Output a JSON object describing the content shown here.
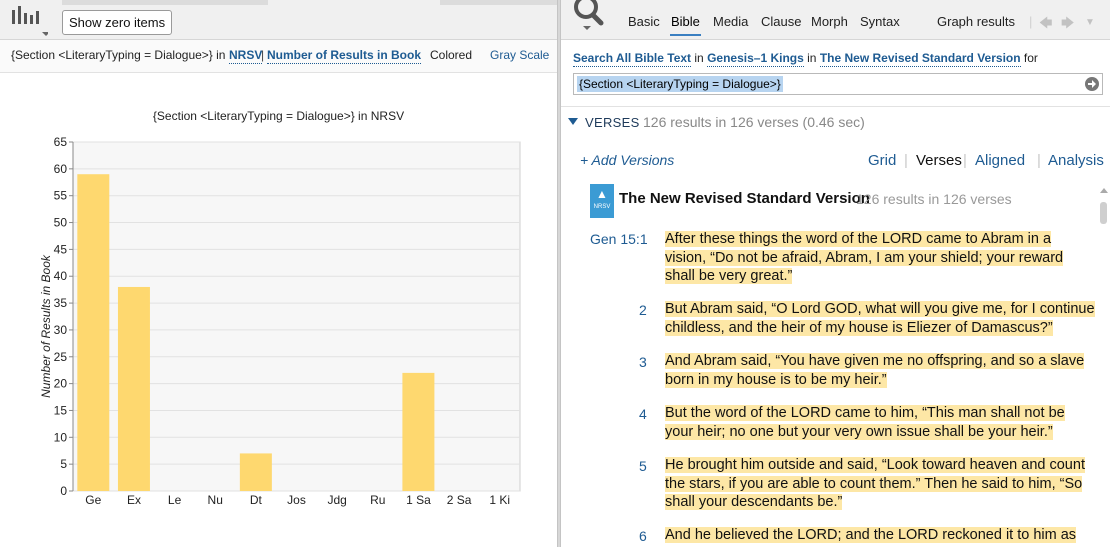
{
  "left_panel": {
    "show_zero_button": "Show zero items",
    "query_label": "{Section <LiteraryTyping = Dialogue>} in",
    "version_link": "NRSV",
    "separator": "|",
    "metric_link": "Number of Results in Book",
    "colored_label": "Colored",
    "grayscale_label": "Gray Scale"
  },
  "chart_data": {
    "type": "bar",
    "title": "{Section <LiteraryTyping = Dialogue>} in NRSV",
    "xlabel": "",
    "ylabel": "Number of Results in Book",
    "categories": [
      "Ge",
      "Ex",
      "Le",
      "Nu",
      "Dt",
      "Jos",
      "Jdg",
      "Ru",
      "1 Sa",
      "2 Sa",
      "1 Ki"
    ],
    "values": [
      59,
      38,
      0,
      0,
      7,
      0,
      0,
      0,
      22,
      0,
      0
    ],
    "ylim": [
      0,
      65
    ],
    "yticks": [
      0,
      5,
      10,
      15,
      20,
      25,
      30,
      35,
      40,
      45,
      50,
      55,
      60,
      65
    ],
    "grid": true,
    "bar_color": "#fed86f"
  },
  "right_panel": {
    "tabs": [
      "Basic",
      "Bible",
      "Media",
      "Clause",
      "Morph",
      "Syntax",
      "Graph results"
    ],
    "active_tab": "Bible",
    "search_line": {
      "prefix": "Search All Bible Text",
      "in1": "in",
      "range": "Genesis–1 Kings",
      "in2": "in",
      "version": "The New Revised Standard Version",
      "for": "for"
    },
    "search_query": "{Section <LiteraryTyping = Dialogue>}",
    "verses_header": "VERSES",
    "verses_count": "126 results in 126 verses (0.46 sec)",
    "add_versions": "+ Add Versions",
    "view_tabs": [
      "Grid",
      "Verses",
      "Aligned",
      "Analysis"
    ],
    "active_view": "Verses",
    "book": {
      "icon_text": "NRSV",
      "name": "The New Revised Standard Version",
      "count": "126 results in 126 verses"
    },
    "verses": [
      {
        "ref": "Gen 15:1",
        "text": "After these things the word of the LORD came to Abram in a vision, “Do not be afraid, Abram, I am your shield; your reward shall be very great.”"
      },
      {
        "ref": "2",
        "text": "But Abram said, “O Lord GOD, what will you give me, for I continue childless, and the heir of my house is Eliezer of Damascus?”"
      },
      {
        "ref": "3",
        "text": "And Abram said, “You have given me no offspring, and so a slave born in my house is to be my heir.”"
      },
      {
        "ref": "4",
        "text": "But the word of the LORD came to him, “This man shall not be your heir; no one but your very own issue shall be your heir.”"
      },
      {
        "ref": "5",
        "text": "He brought him outside and said, “Look toward heaven and count the stars, if you are able to count them.” Then he said to him, “So shall your descendants be.”"
      },
      {
        "ref": "6",
        "text": "And he believed the LORD; and the LORD reckoned it to him as"
      }
    ]
  },
  "colors": {
    "accent": "#1e5b92",
    "highlight": "#fde7a6",
    "bar": "#fed86f"
  }
}
